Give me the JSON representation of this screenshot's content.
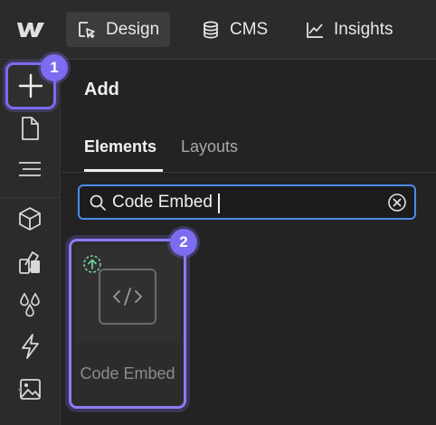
{
  "topbar": {
    "tabs": [
      {
        "label": "Design",
        "icon": "cursor-square-icon",
        "active": true
      },
      {
        "label": "CMS",
        "icon": "database-icon",
        "active": false
      },
      {
        "label": "Insights",
        "icon": "chart-line-icon",
        "active": false
      }
    ]
  },
  "leftbar": {
    "items": [
      "add-elements",
      "pages",
      "navigator",
      "components",
      "style-selectors",
      "variables",
      "interactions",
      "assets"
    ]
  },
  "badges": {
    "one": "1",
    "two": "2"
  },
  "panel": {
    "title": "Add",
    "tabs": [
      {
        "label": "Elements",
        "active": true
      },
      {
        "label": "Layouts",
        "active": false
      }
    ],
    "search": {
      "value": "Code Embed",
      "placeholder": "Search"
    },
    "results": [
      {
        "label": "Code Embed",
        "icon": "code-icon"
      }
    ]
  },
  "colors": {
    "accent": "#7b6cf0",
    "focus": "#4a8be8",
    "upgrade": "#6fcf97"
  }
}
